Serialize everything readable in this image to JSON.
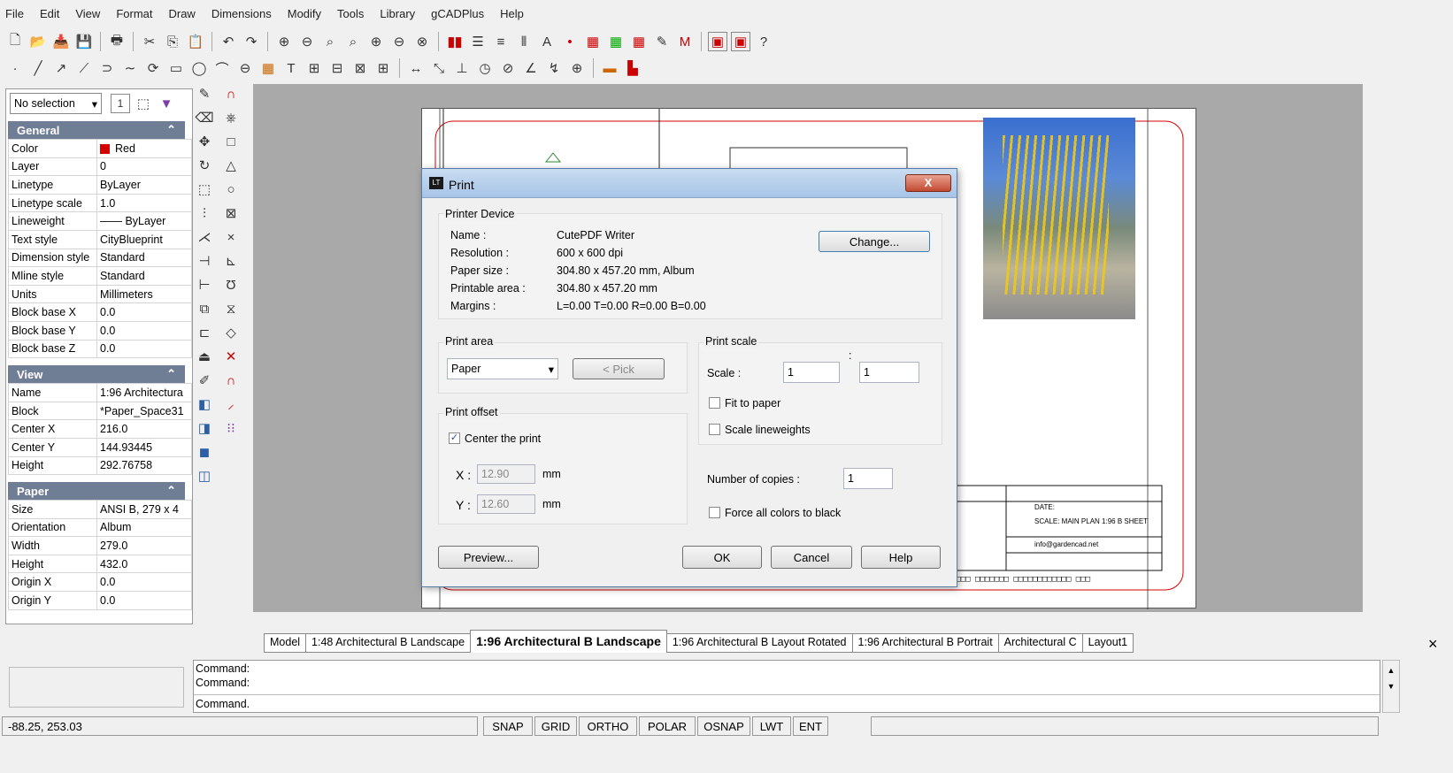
{
  "menu": [
    "File",
    "Edit",
    "View",
    "Format",
    "Draw",
    "Dimensions",
    "Modify",
    "Tools",
    "Library",
    "gCADPlus",
    "Help"
  ],
  "selection": "No selection",
  "general": {
    "title": "General",
    "rows": [
      [
        "Color",
        "Red"
      ],
      [
        "Layer",
        "0"
      ],
      [
        "Linetype",
        "ByLayer"
      ],
      [
        "Linetype scale",
        "1.0"
      ],
      [
        "Lineweight",
        "—— ByLayer"
      ],
      [
        "Text style",
        "CityBlueprint"
      ],
      [
        "Dimension style",
        "Standard"
      ],
      [
        "Mline style",
        "Standard"
      ],
      [
        "Units",
        "Millimeters"
      ],
      [
        "Block base X",
        "0.0"
      ],
      [
        "Block base Y",
        "0.0"
      ],
      [
        "Block base Z",
        "0.0"
      ]
    ]
  },
  "view": {
    "title": "View",
    "rows": [
      [
        "Name",
        "1:96 Architectura"
      ],
      [
        "Block",
        "*Paper_Space31"
      ],
      [
        "Center X",
        "216.0"
      ],
      [
        "Center Y",
        "144.93445"
      ],
      [
        "Height",
        "292.76758"
      ]
    ]
  },
  "paper": {
    "title": "Paper",
    "rows": [
      [
        "Size",
        "ANSI B, 279 x 4"
      ],
      [
        "Orientation",
        "Album"
      ],
      [
        "Width",
        "279.0"
      ],
      [
        "Height",
        "432.0"
      ],
      [
        "Origin X",
        "0.0"
      ],
      [
        "Origin Y",
        "0.0"
      ]
    ]
  },
  "tabs": [
    "Model",
    "1:48 Architectural B Landscape",
    "1:96 Architectural B Landscape",
    "1:96 Architectural B Layout Rotated",
    "1:96 Architectural B Portrait",
    "Architectural C",
    "Layout1"
  ],
  "active_tab": 2,
  "close_x": "×",
  "command_lines": [
    "Command:",
    "Command:",
    "Command."
  ],
  "coords": "-88.25, 253.03",
  "toggles": [
    "SNAP",
    "GRID",
    "ORTHO",
    "POLAR",
    "OSNAP",
    "LWT",
    "ENT"
  ],
  "titleblock": {
    "date": "DATE:",
    "scale": "SCALE: MAIN PLAN 1:96 B SHEET",
    "email": "info@gardencad.net"
  },
  "dialog": {
    "title": "Print",
    "close": "X",
    "printer_group": "Printer Device",
    "name_label": "Name :",
    "name_value": "CutePDF Writer",
    "res_label": "Resolution :",
    "res_value": "600 x 600 dpi",
    "paper_label": "Paper size :",
    "paper_value": "304.80 x 457.20 mm,  Album",
    "printable_label": "Printable area :",
    "printable_value": "304.80 x 457.20 mm",
    "margins_label": "Margins :",
    "margins_value": "L=0.00  T=0.00  R=0.00  B=0.00",
    "change": "Change...",
    "area_group": "Print area",
    "area_value": "Paper",
    "pick": "< Pick",
    "offset_group": "Print offset",
    "center_label": "Center the print",
    "x_label": "X :",
    "x_value": "12.90",
    "y_label": "Y :",
    "y_value": "12.60",
    "mm": "mm",
    "scale_group": "Print scale",
    "scale_label": "Scale :",
    "scale_a": "1",
    "scale_b": "1",
    "colon": ":",
    "fit": "Fit to paper",
    "scale_lw": "Scale lineweights",
    "copies_label": "Number of copies :",
    "copies_value": "1",
    "force_black": "Force all colors to black",
    "preview": "Preview...",
    "ok": "OK",
    "cancel": "Cancel",
    "help": "Help"
  },
  "colors": {
    "red": "#d40000",
    "accent": "#6f7d95"
  }
}
